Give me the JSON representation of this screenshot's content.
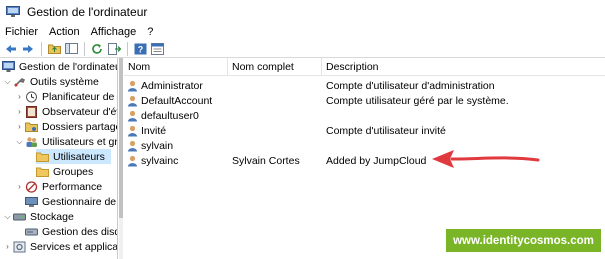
{
  "window": {
    "title": "Gestion de l'ordinateur"
  },
  "menu": {
    "items": [
      "Fichier",
      "Action",
      "Affichage",
      "?"
    ]
  },
  "toolbar": {
    "icons": [
      "back-arrow-icon",
      "forward-arrow-icon",
      "up-folder-icon",
      "show-hide-tree-icon",
      "refresh-icon",
      "export-list-icon",
      "help-icon",
      "properties-icon"
    ]
  },
  "tree": {
    "items": [
      {
        "label": "Gestion de l'ordinateur (l",
        "icon": "computer-management-icon"
      },
      {
        "label": "Outils système",
        "icon": "system-tools-icon"
      },
      {
        "label": "Planificateur de tâc",
        "icon": "task-scheduler-icon"
      },
      {
        "label": "Observateur d'évén",
        "icon": "event-viewer-icon"
      },
      {
        "label": "Dossiers partagés",
        "icon": "shared-folders-icon"
      },
      {
        "label": "Utilisateurs et grou",
        "icon": "users-groups-icon"
      },
      {
        "label": "Utilisateurs",
        "icon": "folder-icon"
      },
      {
        "label": "Groupes",
        "icon": "folder-icon"
      },
      {
        "label": "Performance",
        "icon": "performance-icon"
      },
      {
        "label": "Gestionnaire de pé",
        "icon": "device-manager-icon"
      },
      {
        "label": "Stockage",
        "icon": "storage-icon"
      },
      {
        "label": "Gestion des disque",
        "icon": "disk-management-icon"
      },
      {
        "label": "Services et applicatio",
        "icon": "services-icon"
      }
    ]
  },
  "list": {
    "columns": [
      "Nom",
      "Nom complet",
      "Description"
    ],
    "rows": [
      {
        "name": "Administrator",
        "fullname": "",
        "description": "Compte d'utilisateur d'administration"
      },
      {
        "name": "DefaultAccount",
        "fullname": "",
        "description": "Compte utilisateur géré par le système."
      },
      {
        "name": "defaultuser0",
        "fullname": "",
        "description": ""
      },
      {
        "name": "Invité",
        "fullname": "",
        "description": "Compte d'utilisateur invité"
      },
      {
        "name": "sylvain",
        "fullname": "",
        "description": ""
      },
      {
        "name": "sylvainc",
        "fullname": "Sylvain Cortes",
        "description": "Added by JumpCloud"
      }
    ]
  },
  "watermark": {
    "text": "www.identitycosmos.com"
  },
  "colors": {
    "selection": "#cce8ff",
    "arrow": "#e0393e",
    "watermark_bg": "#7ab527"
  }
}
